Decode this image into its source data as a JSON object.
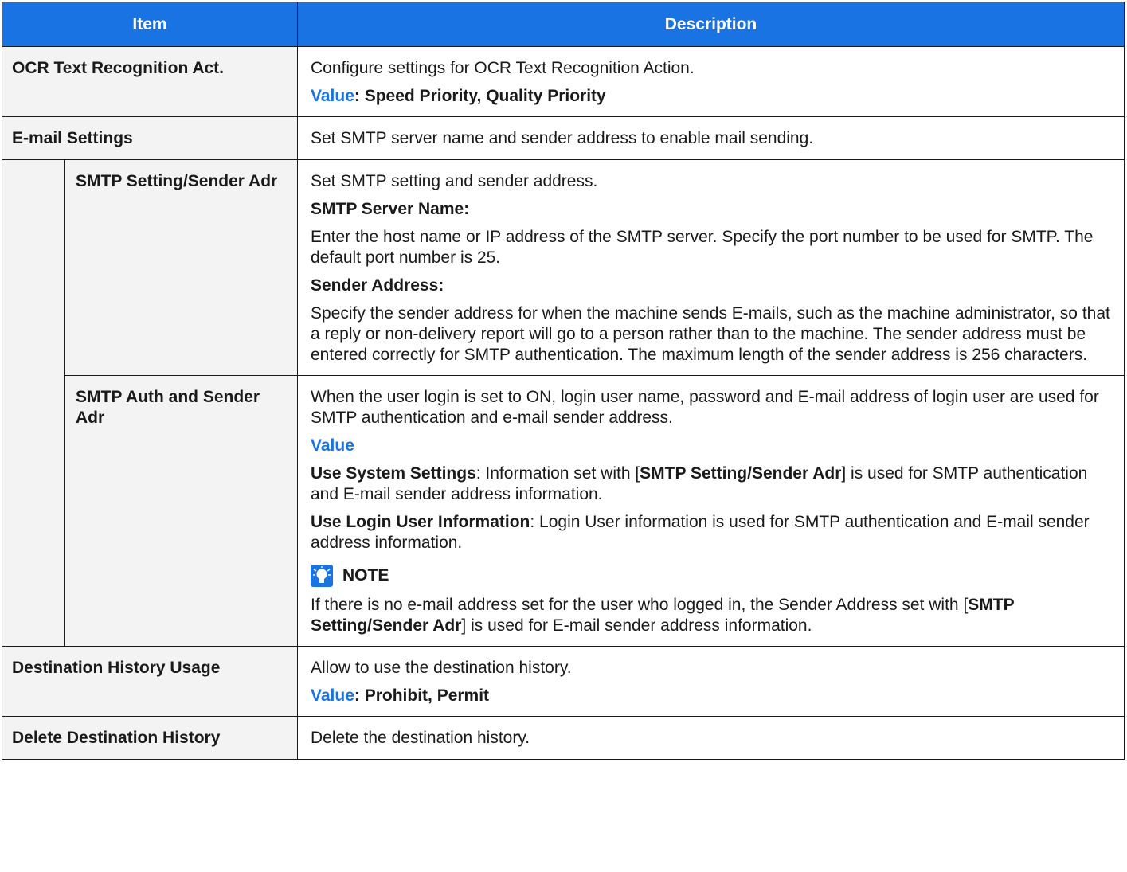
{
  "header": {
    "item": "Item",
    "description": "Description"
  },
  "rows": {
    "ocr": {
      "item": "OCR Text Recognition Act.",
      "desc": "Configure settings for OCR Text Recognition Action.",
      "value_label": "Value",
      "value_text": ": Speed Priority, Quality Priority"
    },
    "email": {
      "item": "E-mail Settings",
      "desc": "Set SMTP server name and sender address to enable mail sending."
    },
    "smtp_setting": {
      "item": "SMTP Setting/Sender Adr",
      "desc": "Set SMTP setting and sender address.",
      "server_heading": "SMTP Server Name:",
      "server_text": "Enter the host name or IP address of the SMTP server. Specify the port number to be used for SMTP. The default port number is 25.",
      "sender_heading": "Sender Address:",
      "sender_text": "Specify the sender address for when the machine sends E-mails, such as the machine administrator, so that a reply or non-delivery report will go to a person rather than to the machine. The sender address must be entered correctly for SMTP authentication. The maximum length of the sender address is 256 characters."
    },
    "smtp_auth": {
      "item": "SMTP Auth and Sender Adr",
      "desc": "When the user login is set to ON, login user name, password and E-mail address of login user are used for SMTP authentication and e-mail sender address.",
      "value_label": "Value",
      "opt1_label": "Use System Settings",
      "opt1_a": ": Information set with [",
      "opt1_ref": "SMTP Setting/Sender Adr",
      "opt1_b": "] is used for SMTP authentication and E-mail sender address information.",
      "opt2_label": "Use Login User Information",
      "opt2_text": ": Login User information is used for SMTP authentication and E-mail sender address information.",
      "note_label": "NOTE",
      "note_a": "If there is no e-mail address set for the user who logged in, the Sender Address set with [",
      "note_ref": "SMTP Setting/Sender Adr",
      "note_b": "] is used for E-mail sender address information."
    },
    "dest_usage": {
      "item": "Destination History Usage",
      "desc": "Allow to use the destination history.",
      "value_label": "Value",
      "value_text": ": Prohibit, Permit"
    },
    "dest_delete": {
      "item": "Delete Destination History",
      "desc": "Delete the destination history."
    }
  },
  "colors": {
    "header_bg": "#1a73e3",
    "accent": "#1a73e3",
    "item_bg": "#f3f3f3"
  }
}
